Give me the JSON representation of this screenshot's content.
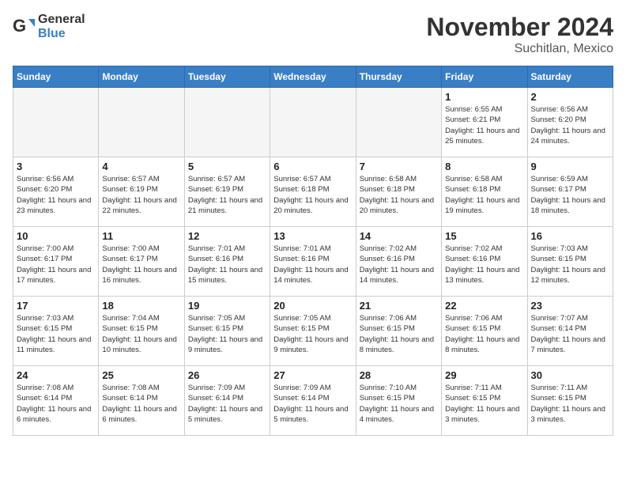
{
  "logo": {
    "general": "General",
    "blue": "Blue"
  },
  "title": "November 2024",
  "location": "Suchitlan, Mexico",
  "days_of_week": [
    "Sunday",
    "Monday",
    "Tuesday",
    "Wednesday",
    "Thursday",
    "Friday",
    "Saturday"
  ],
  "weeks": [
    [
      {
        "day": "",
        "info": ""
      },
      {
        "day": "",
        "info": ""
      },
      {
        "day": "",
        "info": ""
      },
      {
        "day": "",
        "info": ""
      },
      {
        "day": "",
        "info": ""
      },
      {
        "day": "1",
        "info": "Sunrise: 6:55 AM\nSunset: 6:21 PM\nDaylight: 11 hours and 25 minutes."
      },
      {
        "day": "2",
        "info": "Sunrise: 6:56 AM\nSunset: 6:20 PM\nDaylight: 11 hours and 24 minutes."
      }
    ],
    [
      {
        "day": "3",
        "info": "Sunrise: 6:56 AM\nSunset: 6:20 PM\nDaylight: 11 hours and 23 minutes."
      },
      {
        "day": "4",
        "info": "Sunrise: 6:57 AM\nSunset: 6:19 PM\nDaylight: 11 hours and 22 minutes."
      },
      {
        "day": "5",
        "info": "Sunrise: 6:57 AM\nSunset: 6:19 PM\nDaylight: 11 hours and 21 minutes."
      },
      {
        "day": "6",
        "info": "Sunrise: 6:57 AM\nSunset: 6:18 PM\nDaylight: 11 hours and 20 minutes."
      },
      {
        "day": "7",
        "info": "Sunrise: 6:58 AM\nSunset: 6:18 PM\nDaylight: 11 hours and 20 minutes."
      },
      {
        "day": "8",
        "info": "Sunrise: 6:58 AM\nSunset: 6:18 PM\nDaylight: 11 hours and 19 minutes."
      },
      {
        "day": "9",
        "info": "Sunrise: 6:59 AM\nSunset: 6:17 PM\nDaylight: 11 hours and 18 minutes."
      }
    ],
    [
      {
        "day": "10",
        "info": "Sunrise: 7:00 AM\nSunset: 6:17 PM\nDaylight: 11 hours and 17 minutes."
      },
      {
        "day": "11",
        "info": "Sunrise: 7:00 AM\nSunset: 6:17 PM\nDaylight: 11 hours and 16 minutes."
      },
      {
        "day": "12",
        "info": "Sunrise: 7:01 AM\nSunset: 6:16 PM\nDaylight: 11 hours and 15 minutes."
      },
      {
        "day": "13",
        "info": "Sunrise: 7:01 AM\nSunset: 6:16 PM\nDaylight: 11 hours and 14 minutes."
      },
      {
        "day": "14",
        "info": "Sunrise: 7:02 AM\nSunset: 6:16 PM\nDaylight: 11 hours and 14 minutes."
      },
      {
        "day": "15",
        "info": "Sunrise: 7:02 AM\nSunset: 6:16 PM\nDaylight: 11 hours and 13 minutes."
      },
      {
        "day": "16",
        "info": "Sunrise: 7:03 AM\nSunset: 6:15 PM\nDaylight: 11 hours and 12 minutes."
      }
    ],
    [
      {
        "day": "17",
        "info": "Sunrise: 7:03 AM\nSunset: 6:15 PM\nDaylight: 11 hours and 11 minutes."
      },
      {
        "day": "18",
        "info": "Sunrise: 7:04 AM\nSunset: 6:15 PM\nDaylight: 11 hours and 10 minutes."
      },
      {
        "day": "19",
        "info": "Sunrise: 7:05 AM\nSunset: 6:15 PM\nDaylight: 11 hours and 9 minutes."
      },
      {
        "day": "20",
        "info": "Sunrise: 7:05 AM\nSunset: 6:15 PM\nDaylight: 11 hours and 9 minutes."
      },
      {
        "day": "21",
        "info": "Sunrise: 7:06 AM\nSunset: 6:15 PM\nDaylight: 11 hours and 8 minutes."
      },
      {
        "day": "22",
        "info": "Sunrise: 7:06 AM\nSunset: 6:15 PM\nDaylight: 11 hours and 8 minutes."
      },
      {
        "day": "23",
        "info": "Sunrise: 7:07 AM\nSunset: 6:14 PM\nDaylight: 11 hours and 7 minutes."
      }
    ],
    [
      {
        "day": "24",
        "info": "Sunrise: 7:08 AM\nSunset: 6:14 PM\nDaylight: 11 hours and 6 minutes."
      },
      {
        "day": "25",
        "info": "Sunrise: 7:08 AM\nSunset: 6:14 PM\nDaylight: 11 hours and 6 minutes."
      },
      {
        "day": "26",
        "info": "Sunrise: 7:09 AM\nSunset: 6:14 PM\nDaylight: 11 hours and 5 minutes."
      },
      {
        "day": "27",
        "info": "Sunrise: 7:09 AM\nSunset: 6:14 PM\nDaylight: 11 hours and 5 minutes."
      },
      {
        "day": "28",
        "info": "Sunrise: 7:10 AM\nSunset: 6:15 PM\nDaylight: 11 hours and 4 minutes."
      },
      {
        "day": "29",
        "info": "Sunrise: 7:11 AM\nSunset: 6:15 PM\nDaylight: 11 hours and 3 minutes."
      },
      {
        "day": "30",
        "info": "Sunrise: 7:11 AM\nSunset: 6:15 PM\nDaylight: 11 hours and 3 minutes."
      }
    ]
  ]
}
